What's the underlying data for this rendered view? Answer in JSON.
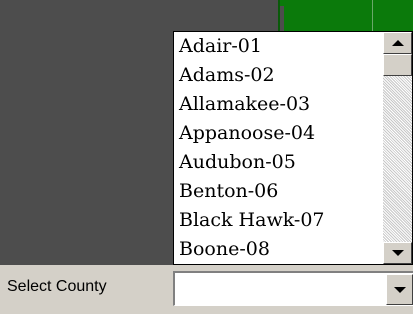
{
  "dropdown": {
    "items": [
      "Adair-01",
      "Adams-02",
      "Allamakee-03",
      "Appanoose-04",
      "Audubon-05",
      "Benton-06",
      "Black Hawk-07",
      "Boone-08"
    ]
  },
  "county_select": {
    "label": "Select County",
    "value": ""
  },
  "icons": {
    "scroll_up": "chevron-up-icon",
    "scroll_down": "chevron-down-icon",
    "combo_arrow": "chevron-down-icon"
  },
  "colors": {
    "map_background": "#4d4d4d",
    "map_county_fill": "#0b7a0b",
    "control_face": "#d4d0c8"
  }
}
